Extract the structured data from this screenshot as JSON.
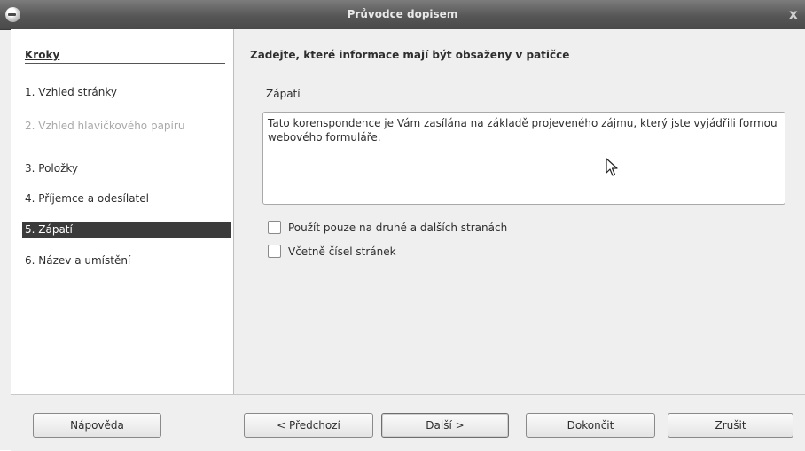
{
  "window": {
    "title": "Průvodce dopisem",
    "close_glyph": "x"
  },
  "steps": {
    "heading": "Kroky",
    "items": [
      {
        "label": "1. Vzhled stránky",
        "state": "normal"
      },
      {
        "label": "2. Vzhled hlavičkového papíru",
        "state": "disabled"
      },
      {
        "label": "3. Položky",
        "state": "normal"
      },
      {
        "label": "4. Příjemce a odesílatel",
        "state": "normal"
      },
      {
        "label": "5. Zápatí",
        "state": "active"
      },
      {
        "label": "6. Název a umístění",
        "state": "normal"
      }
    ]
  },
  "content": {
    "heading": "Zadejte, které informace mají být obsaženy v patičce",
    "footer_label": "Zápatí",
    "footer_text": "Tato korenspondence je Vám zasílána na základě projeveného zájmu, který jste vyjádřili formou webového formuláře.",
    "checkbox_second_pages": {
      "label": "Použít pouze na druhé a dalších stranách",
      "checked": false
    },
    "checkbox_page_numbers": {
      "label": "Včetně čísel stránek",
      "checked": false
    }
  },
  "buttons": {
    "help": "Nápověda",
    "back": "< Předchozí",
    "next": "Další >",
    "finish": "Dokončit",
    "cancel": "Zrušit"
  },
  "icons": {
    "app": "app-icon",
    "cursor": "mouse-pointer-icon"
  }
}
